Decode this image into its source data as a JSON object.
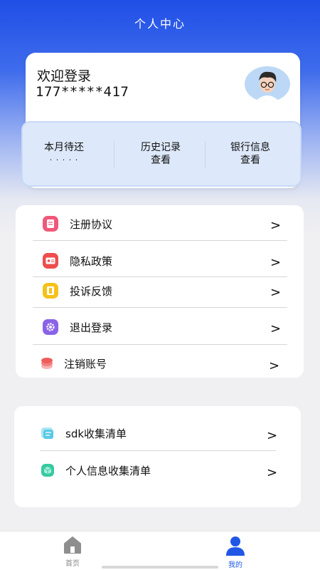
{
  "header": {
    "title": "个人中心"
  },
  "profile": {
    "welcome": "欢迎登录",
    "phone": "177*****417"
  },
  "stats": [
    {
      "title": "本月待还",
      "value": "· · · · ·"
    },
    {
      "title": "历史记录",
      "value": "查看"
    },
    {
      "title": "银行信息",
      "value": "查看"
    }
  ],
  "menu_main": [
    {
      "label": "注册协议",
      "icon": "document-icon",
      "color": "#f0587a"
    },
    {
      "label": "隐私政策",
      "icon": "id-card-icon",
      "color": "#ee4d4d"
    },
    {
      "label": "投诉反馈",
      "icon": "ticket-icon",
      "color": "#f5c21b"
    },
    {
      "label": "退出登录",
      "icon": "gear-icon",
      "color": "#8a63e8"
    },
    {
      "label": "注销账号",
      "icon": "stack-icon",
      "color": "#f27f7f"
    }
  ],
  "menu_extra": [
    {
      "label": "sdk收集清单",
      "icon": "list-icon",
      "color": "#5bc9e6"
    },
    {
      "label": "个人信息收集清单",
      "icon": "cube-icon",
      "color": "#37c9a2"
    }
  ],
  "chevron": ">",
  "tabs": [
    {
      "label": "首页",
      "icon": "home-icon",
      "active": false
    },
    {
      "label": "我的",
      "icon": "person-icon",
      "active": true
    }
  ],
  "colors": {
    "primary": "#1f4fe6",
    "tab_active": "#2057e6",
    "tab_inactive": "#8a8a8a"
  }
}
